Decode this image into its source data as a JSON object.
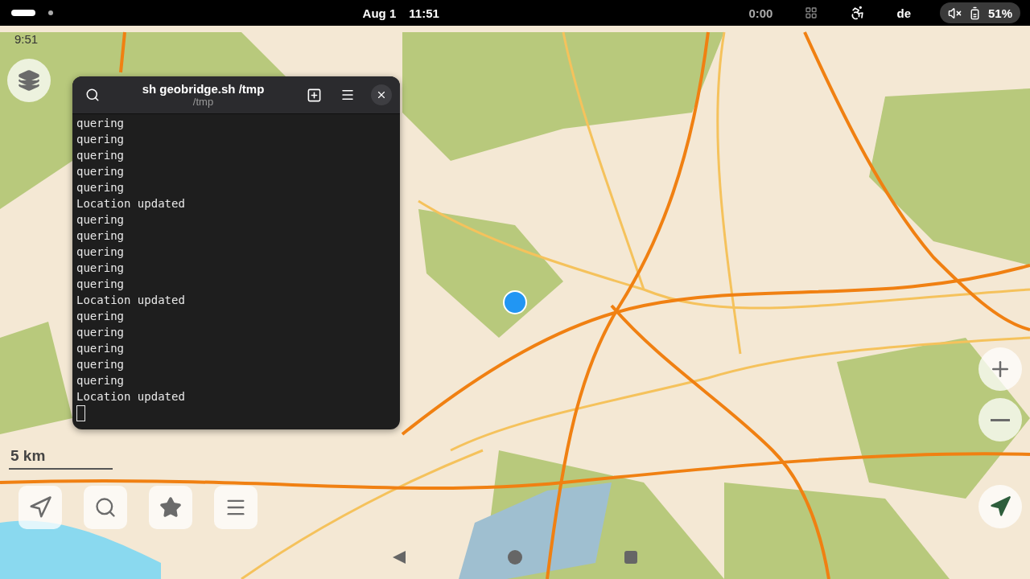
{
  "status_bar": {
    "date": "Aug 1",
    "time": "11:51",
    "timer": "0:00",
    "language": "de",
    "battery": "51%"
  },
  "map_app": {
    "clock": "9:51",
    "scale": "5 km"
  },
  "terminal": {
    "title": "sh geobridge.sh /tmp",
    "subtitle": "/tmp",
    "lines": [
      "quering",
      "quering",
      "quering",
      "quering",
      "quering",
      "Location updated",
      "quering",
      "quering",
      "quering",
      "quering",
      "quering",
      "Location updated",
      "quering",
      "quering",
      "quering",
      "quering",
      "quering",
      "Location updated"
    ]
  }
}
